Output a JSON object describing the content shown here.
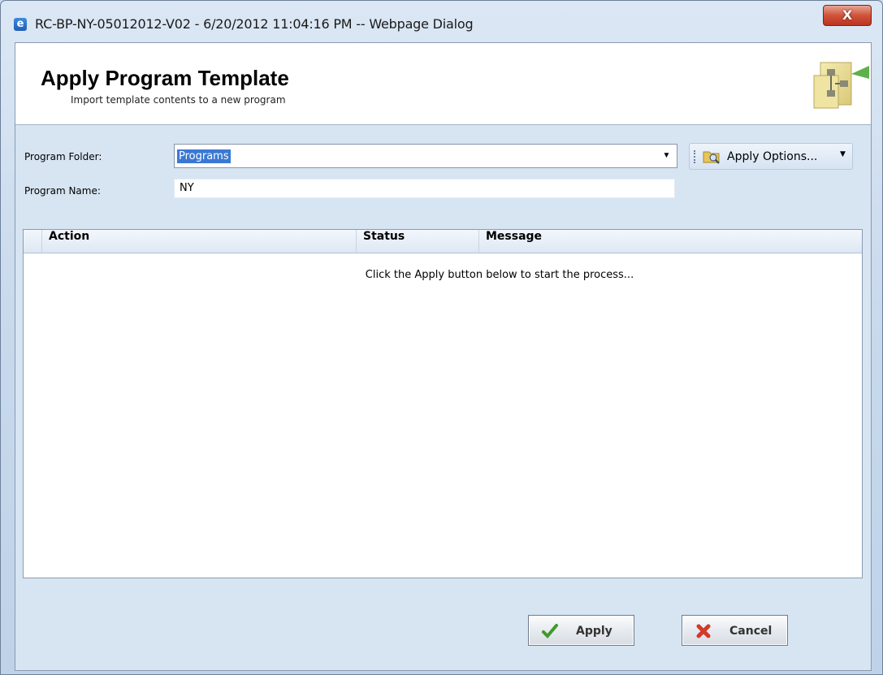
{
  "window": {
    "title": "RC-BP-NY-05012012-V02 - 6/20/2012 11:04:16 PM -- Webpage Dialog",
    "close_label": "X"
  },
  "header": {
    "title": "Apply Program Template",
    "subtitle": "Import template contents to a new program"
  },
  "form": {
    "folder_label": "Program Folder:",
    "folder_value": "Programs",
    "name_label": "Program Name:",
    "name_value": "NY",
    "apply_options_label": "Apply Options..."
  },
  "grid": {
    "columns": [
      "Action",
      "Status",
      "Message"
    ],
    "empty_message": "Click the Apply button below to start the process..."
  },
  "buttons": {
    "apply_label": "Apply",
    "cancel_label": "Cancel"
  },
  "colors": {
    "selection": "#3a78d4",
    "close_red": "#d0533a",
    "background": "#d7e4f2"
  }
}
